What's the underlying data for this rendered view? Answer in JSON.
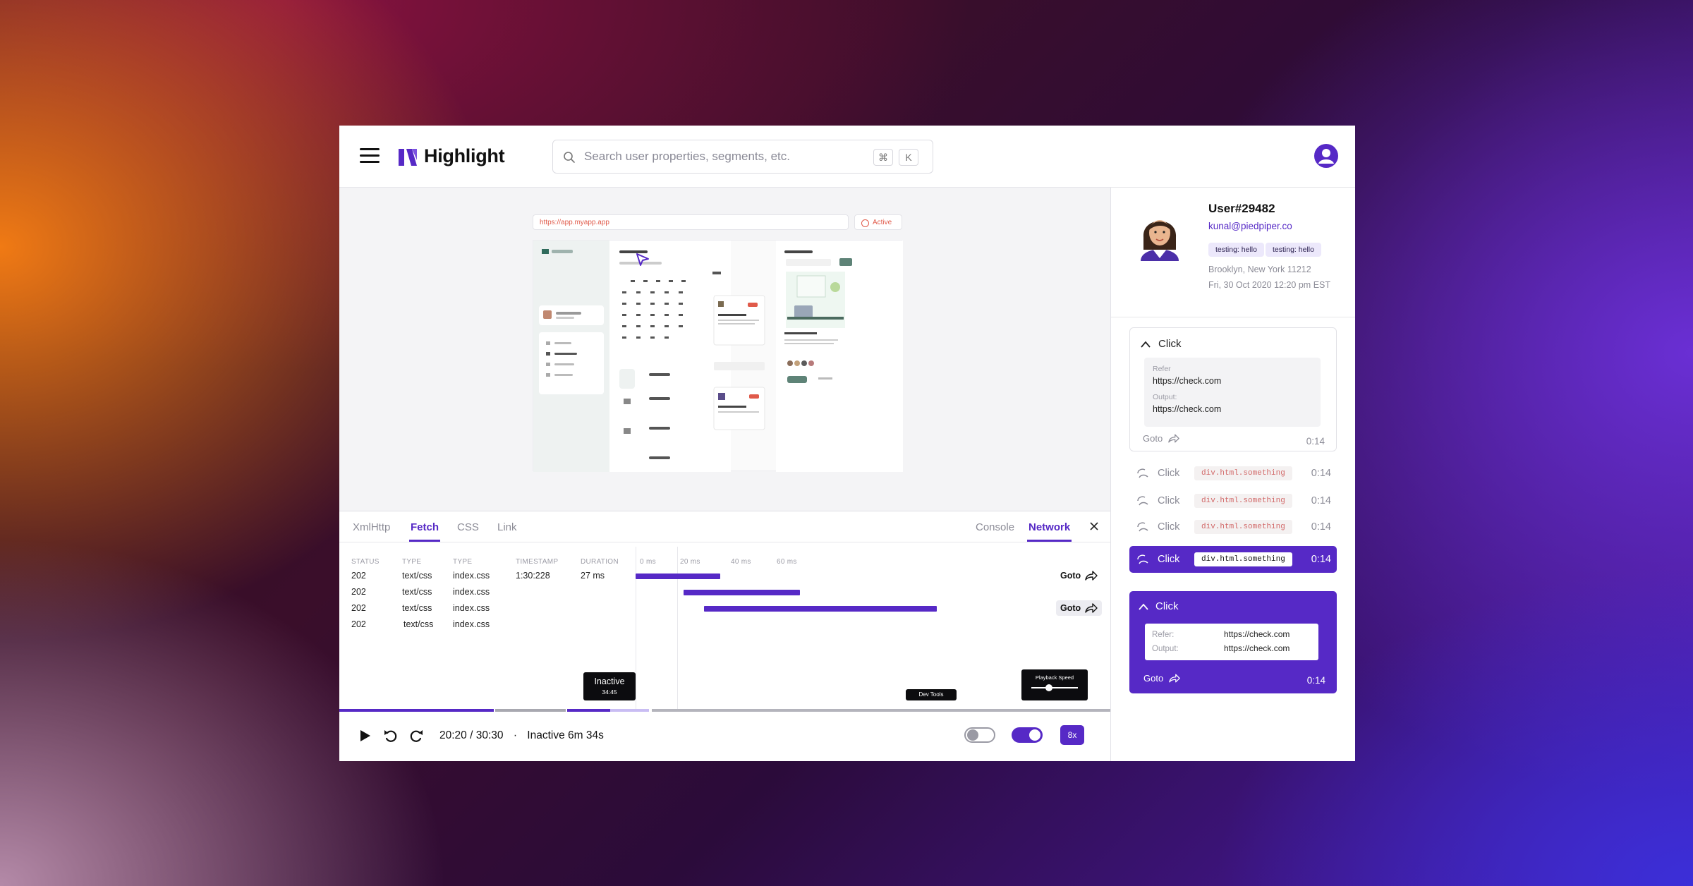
{
  "header": {
    "logo_text": "Highlight",
    "search_placeholder": "Search user properties, segments, etc.",
    "shortcut_keys": [
      "⌘",
      "K"
    ]
  },
  "replay_preview": {
    "url": "https://app.myapp.app",
    "status": "Active"
  },
  "devtools": {
    "left_tabs": [
      "XmlHttp",
      "Fetch",
      "CSS",
      "Link"
    ],
    "active_left_tab": "Fetch",
    "right_tabs": [
      "Console",
      "Network"
    ],
    "active_right_tab": "Network",
    "columns": [
      "STATUS",
      "TYPE",
      "TYPE",
      "TIMESTAMP",
      "DURATION"
    ],
    "scale_ticks": [
      "0 ms",
      "20 ms",
      "40 ms",
      "60 ms"
    ],
    "rows": [
      {
        "status": "202",
        "type": "text/css",
        "file": "index.css",
        "timestamp": "1:30:228",
        "duration": "27 ms",
        "goto": "Goto"
      },
      {
        "status": "202",
        "type": "text/css",
        "file": "index.css",
        "timestamp": "",
        "duration": "",
        "goto": ""
      },
      {
        "status": "202",
        "type": "text/css",
        "file": "index.css",
        "timestamp": "",
        "duration": "",
        "goto": "Goto"
      },
      {
        "status": "202",
        "type": "text/css",
        "file": "index.css",
        "timestamp": "",
        "duration": "",
        "goto": ""
      }
    ]
  },
  "timeline": {
    "inactive_tooltip_label": "Inactive",
    "inactive_tooltip_time": "34:45",
    "devtools_marker": "Dev Tools",
    "playback_speed_label": "Playback Speed"
  },
  "controls": {
    "time": "20:20 / 30:30",
    "separator": "·",
    "inactive": "Inactive 6m 34s",
    "speed": "8x",
    "toggle1_on": false,
    "toggle2_on": true
  },
  "user": {
    "name": "User#29482",
    "email": "kunal@piedpiper.co",
    "tags": [
      "testing: hello",
      "testing: hello"
    ],
    "location": "Brooklyn, New York 11212",
    "datetime": "Fri, 30 Oct 2020 12:20 pm EST"
  },
  "events": {
    "expanded_card": {
      "title": "Click",
      "refer_label": "Refer",
      "refer": "https://check.com",
      "output_label": "Output:",
      "output": "https://check.com",
      "goto": "Goto",
      "time": "0:14"
    },
    "rows": [
      {
        "name": "Click",
        "code": "div.html.something",
        "time": "0:14"
      },
      {
        "name": "Click",
        "code": "div.html.something",
        "time": "0:14"
      },
      {
        "name": "Click",
        "code": "div.html.something",
        "time": "0:14"
      },
      {
        "name": "Click",
        "code": "div.html.something",
        "time": "0:14"
      }
    ],
    "selected_card": {
      "title": "Click",
      "refer_label": "Refer:",
      "refer": "https://check.com",
      "output_label": "Output:",
      "output": "https://check.com",
      "goto": "Goto",
      "time": "0:14"
    }
  },
  "colors": {
    "accent": "#5629c6",
    "accent_light": "#ece8fb"
  },
  "icons": [
    "menu-icon",
    "logo-icon",
    "search-icon",
    "user-avatar-icon",
    "close-icon",
    "share-arrow-icon",
    "play-icon",
    "rewind-icon",
    "forward-icon",
    "cursor-click-icon",
    "chevron-up-icon"
  ]
}
